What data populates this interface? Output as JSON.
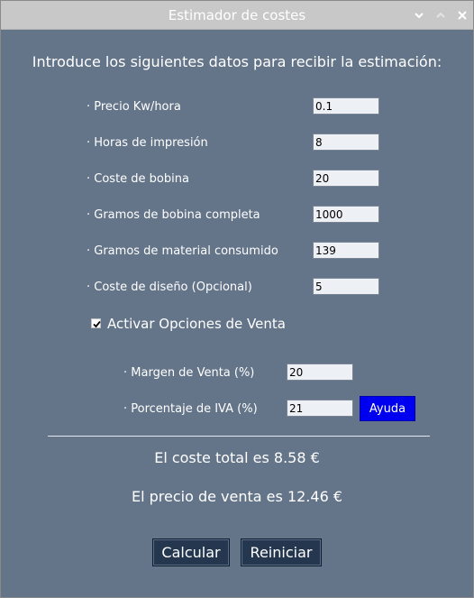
{
  "window": {
    "title": "Estimador de costes"
  },
  "titlebar_icons": [
    "chevron-down-icon",
    "chevron-up-icon",
    "close-icon"
  ],
  "intro": "Introduce los siguientes datos para recibir la estimación:",
  "fields": [
    {
      "label": "· Precio Kw/hora",
      "value": "0.1"
    },
    {
      "label": "· Horas de impresión",
      "value": "8"
    },
    {
      "label": "· Coste de bobina",
      "value": "20"
    },
    {
      "label": "· Gramos de bobina completa",
      "value": "1000"
    },
    {
      "label": "· Gramos de material consumido",
      "value": "139"
    },
    {
      "label": "· Coste de diseño (Opcional)",
      "value": "5"
    }
  ],
  "sales": {
    "checkbox_label": "Activar Opciones de Venta",
    "checked": true,
    "margin_label": "· Margen de Venta (%)",
    "margin_value": "20",
    "vat_label": "· Porcentaje de IVA (%)",
    "vat_value": "21",
    "help_label": "Ayuda"
  },
  "results": {
    "total_cost": "El coste total es 8.58 €",
    "sale_price": "El precio de venta es 12.46 €"
  },
  "actions": {
    "calculate": "Calcular",
    "reset": "Reiniciar"
  },
  "colors": {
    "background": "#647489",
    "titlebar": "#c8c8c8",
    "button": "#25374f",
    "help_button": "#0000f0"
  }
}
